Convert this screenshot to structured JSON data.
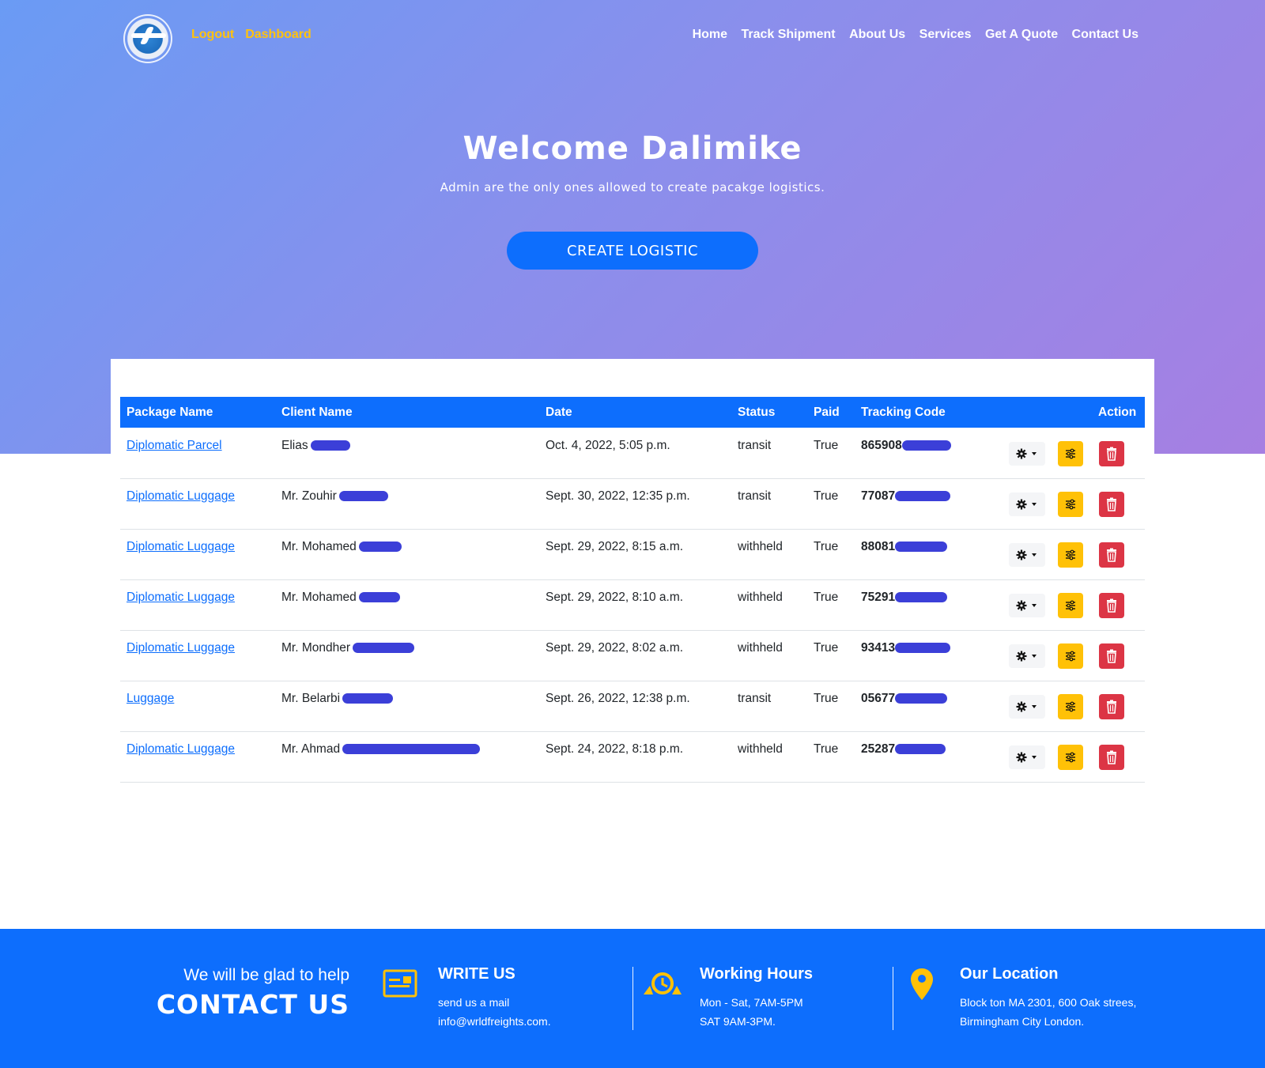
{
  "header": {
    "logout_label": "Logout",
    "dashboard_label": "Dashboard",
    "nav": [
      "Home",
      "Track Shipment",
      "About Us",
      "Services",
      "Get A Quote",
      "Contact Us"
    ]
  },
  "hero": {
    "title": "Welcome Dalimike",
    "subtitle": "Admin are the only ones allowed to create pacakge logistics.",
    "create_button": "CREATE LOGISTIC"
  },
  "table": {
    "headers": {
      "package_name": "Package Name",
      "client_name": "Client Name",
      "date": "Date",
      "status": "Status",
      "paid": "Paid",
      "tracking_code": "Tracking Code",
      "action": "Action"
    },
    "rows": [
      {
        "package": "Diplomatic Parcel",
        "client": "Elias",
        "date": "Oct. 4, 2022, 5:05 p.m.",
        "status": "transit",
        "paid": "True",
        "code": "865908"
      },
      {
        "package": "Diplomatic Luggage",
        "client": "Mr. Zouhir",
        "date": "Sept. 30, 2022, 12:35 p.m.",
        "status": "transit",
        "paid": "True",
        "code": "77087"
      },
      {
        "package": "Diplomatic Luggage",
        "client": "Mr. Mohamed",
        "date": "Sept. 29, 2022, 8:15 a.m.",
        "status": "withheld",
        "paid": "True",
        "code": "88081"
      },
      {
        "package": "Diplomatic Luggage",
        "client": "Mr. Mohamed",
        "date": "Sept. 29, 2022, 8:10 a.m.",
        "status": "withheld",
        "paid": "True",
        "code": "75291"
      },
      {
        "package": "Diplomatic Luggage",
        "client": "Mr. Mondher",
        "date": "Sept. 29, 2022, 8:02 a.m.",
        "status": "withheld",
        "paid": "True",
        "code": "93413"
      },
      {
        "package": "Luggage",
        "client": "Mr. Belarbi",
        "date": "Sept. 26, 2022, 12:38 p.m.",
        "status": "transit",
        "paid": "True",
        "code": "05677"
      },
      {
        "package": "Diplomatic Luggage",
        "client": "Mr. Ahmad",
        "date": "Sept. 24, 2022, 8:18 p.m.",
        "status": "withheld",
        "paid": "True",
        "code": "25287"
      }
    ]
  },
  "footer": {
    "glad": "We will be glad to help",
    "contact_us": "CONTACT US",
    "write_us": {
      "title": "WRITE US",
      "line1": "send us a mail",
      "line2": "info@wrldfreights.com."
    },
    "hours": {
      "title": "Working Hours",
      "line1": "Mon - Sat, 7AM-5PM",
      "line2": "SAT 9AM-3PM."
    },
    "location": {
      "title": "Our Location",
      "line1": "Block ton MA 2301, 600 Oak strees,",
      "line2": "Birmingham City London."
    }
  },
  "colors": {
    "primary": "#0d6efd",
    "accent": "#ffc107",
    "danger": "#dc3545",
    "gold_link": "#ffc20e"
  }
}
